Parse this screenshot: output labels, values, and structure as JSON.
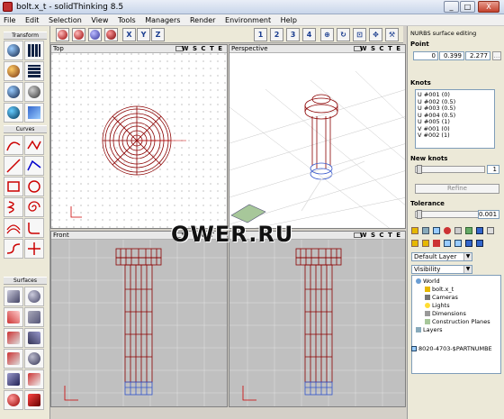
{
  "window": {
    "title": "bolt.x_t - solidThinking 8.5",
    "min_label": "_",
    "max_label": "□",
    "close_label": "X"
  },
  "menu": [
    "File",
    "Edit",
    "Selection",
    "View",
    "Tools",
    "Managers",
    "Render",
    "Environment",
    "Help"
  ],
  "left_panel": {
    "groups": [
      "Transform",
      "Curves",
      "Surfaces"
    ]
  },
  "toolbar": {
    "axis_buttons": [
      "X",
      "Y",
      "Z"
    ],
    "view_buttons": [
      "1",
      "2",
      "3",
      "4"
    ]
  },
  "viewports": {
    "top": {
      "name": "Top",
      "views": "W S C T E"
    },
    "perspective": {
      "name": "Perspective",
      "views": "W S C T E"
    },
    "front": {
      "name": "Front",
      "views": "W S C T E"
    },
    "fourth": {
      "name": "",
      "views": "W S C T E"
    }
  },
  "right_panel": {
    "title": "NURBS surface editing",
    "point_label": "Point",
    "point_values": [
      "0",
      "0.399",
      "2.277"
    ],
    "knots_label": "Knots",
    "knots": [
      "U #001 (0)",
      "U #002 (0.5)",
      "U #003 (0.5)",
      "U #004 (0.5)",
      "U #005 (1)",
      "V #001 (0)",
      "V #002 (1)"
    ],
    "new_knots_label": "New knots",
    "new_knots_value": "1",
    "refine_label": "Refine",
    "tolerance_label": "Tolerance",
    "tolerance_value": "0.001",
    "layer_dropdown": "Default Layer",
    "visibility_dropdown": "Visibility",
    "tree": [
      "World",
      "bolt.x_t",
      "Cameras",
      "Lights",
      "Dimensions",
      "Construction Planes",
      "Layers"
    ],
    "bottom_item": "8020-4703-$PARTNUMBE"
  },
  "watermark": "OWER.RU",
  "colors": {
    "wire": "#8b0000",
    "axis_blue": "#3355cc",
    "accent": "#1a3d8f"
  }
}
